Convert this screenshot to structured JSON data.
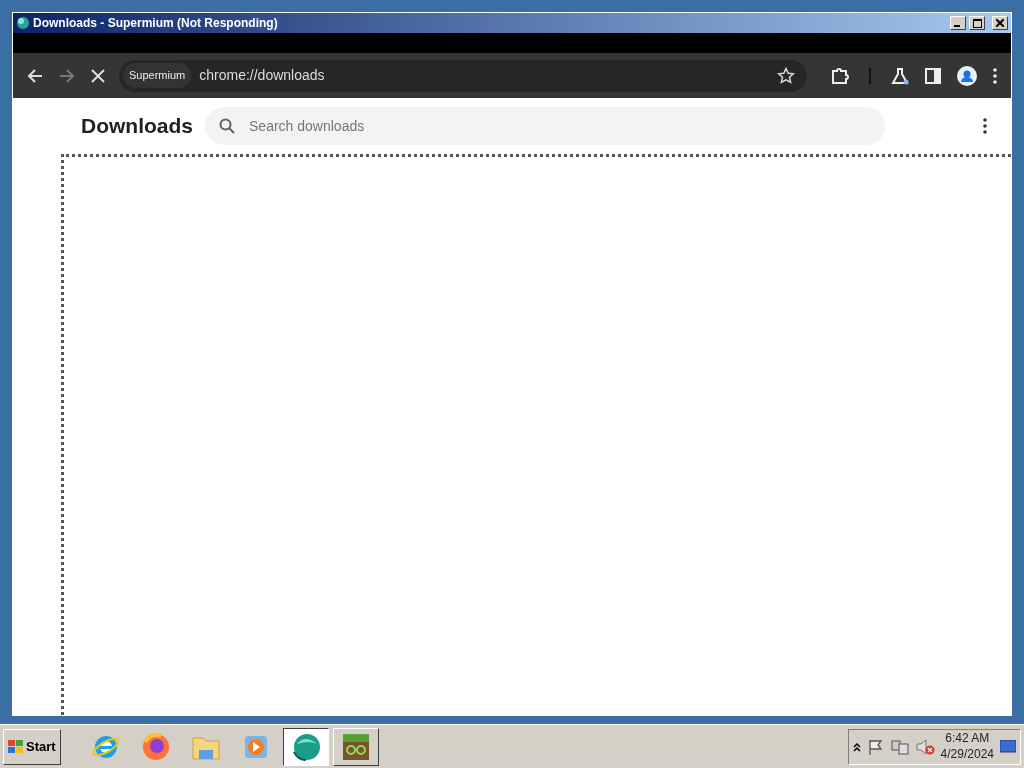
{
  "window": {
    "title": "Downloads - Supermium (Not Responding)"
  },
  "toolbar": {
    "site_chip": "Supermium",
    "url": "chrome://downloads"
  },
  "page": {
    "heading": "Downloads",
    "search": {
      "placeholder": "Search downloads"
    }
  },
  "taskbar": {
    "start": "Start",
    "apps": [
      {
        "kind": "ie",
        "selected": false
      },
      {
        "kind": "firefox",
        "selected": false
      },
      {
        "kind": "folder",
        "selected": false
      },
      {
        "kind": "media",
        "selected": false
      },
      {
        "kind": "supermium",
        "selected": true
      },
      {
        "kind": "game",
        "selected": false
      }
    ],
    "time": "6:42 AM",
    "date": "4/29/2024"
  }
}
